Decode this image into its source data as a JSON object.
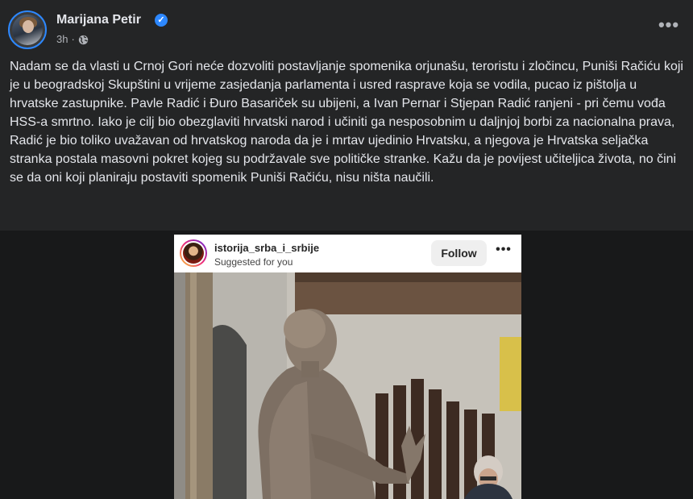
{
  "post": {
    "author": "Marijana Petir",
    "time": "3h",
    "meta_sep": "·",
    "more": "•••",
    "text": "Nadam se da vlasti u Crnoj Gori neće dozvoliti postavljanje spomenika orjunašu, teroristu i zločincu, Puniši Račiću koji je u beogradskoj Skupštini u vrijeme zasjedanja parlamenta i usred rasprave koja se vodila, pucao iz pištolja u hrvatske zastupnike. Pavle Radić i Đuro Basariček su ubijeni, a Ivan Pernar i Stjepan Radić ranjeni - pri čemu vođa HSS-a smrtno. Iako je cilj bio obezglaviti hrvatski narod i učiniti ga nesposobnim u daljnjoj borbi za nacionalna prava, Radić je bio toliko uvažavan od hrvatskog naroda da je i mrtav ujedinio Hrvatsku, a njegova je Hrvatska seljačka stranka postala masovni pokret kojeg su podržavale sve političke stranke. Kažu da je povijest učiteljica života, no čini se da oni koji planiraju postaviti spomenik Puniši Račiću, nisu ništa naučili."
  },
  "embed": {
    "username": "istorija_srba_i_srbije",
    "suggested": "Suggested for you",
    "follow": "Follow",
    "more": "•••"
  },
  "icons": {
    "verified": "verified-badge-icon",
    "globe": "globe-icon",
    "more": "more-dots-icon"
  },
  "colors": {
    "background": "#242526",
    "text": "#e4e6eb",
    "muted": "#b0b3b8",
    "accent": "#2d88ff"
  }
}
